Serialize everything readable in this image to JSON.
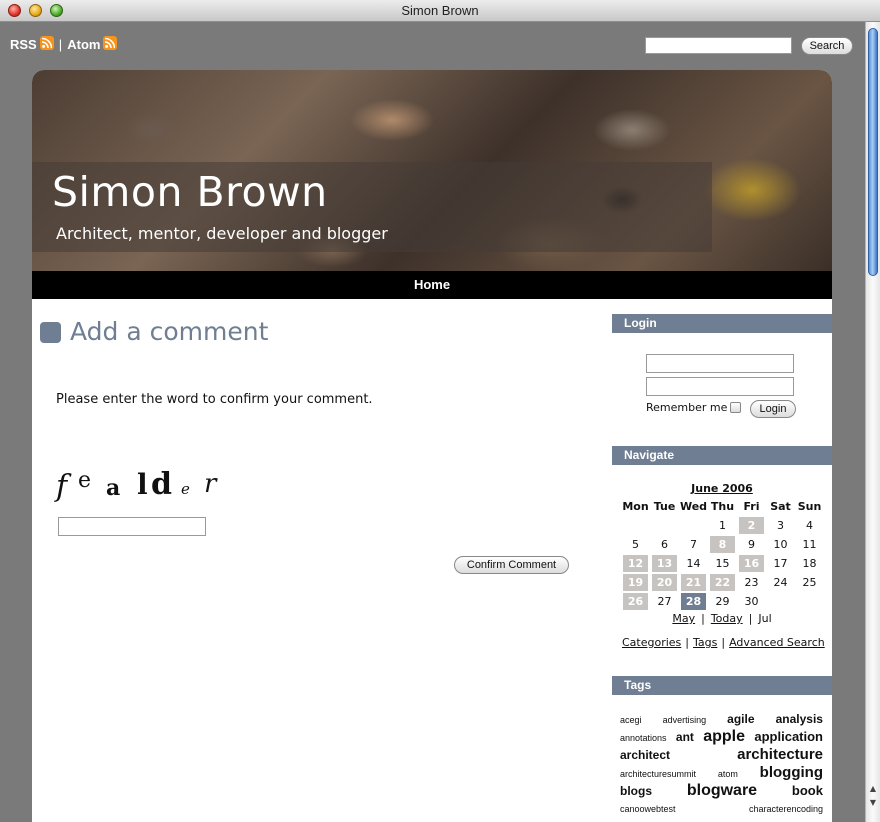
{
  "window": {
    "title": "Simon Brown"
  },
  "feeds": {
    "rss_label": "RSS",
    "separator": "|",
    "atom_label": "Atom"
  },
  "search": {
    "button_label": "Search",
    "value": ""
  },
  "site": {
    "title": "Simon Brown",
    "tagline": "Architect, mentor, developer and blogger"
  },
  "nav": {
    "home_label": "Home"
  },
  "main": {
    "heading": "Add a comment",
    "instructions": "Please enter the word to confirm your comment.",
    "captcha_word": "fealder",
    "confirm_label": "Confirm Comment"
  },
  "sidebar": {
    "login": {
      "header": "Login",
      "remember_label": "Remember me",
      "login_button": "Login"
    },
    "navigate": {
      "header": "Navigate",
      "month_label": "June 2006",
      "weekdays": [
        "Mon",
        "Tue",
        "Wed",
        "Thu",
        "Fri",
        "Sat",
        "Sun"
      ],
      "weeks": [
        [
          "",
          "",
          "",
          "1",
          "2",
          "3",
          "4"
        ],
        [
          "5",
          "6",
          "7",
          "8",
          "9",
          "10",
          "11"
        ],
        [
          "12",
          "13",
          "14",
          "15",
          "16",
          "17",
          "18"
        ],
        [
          "19",
          "20",
          "21",
          "22",
          "23",
          "24",
          "25"
        ],
        [
          "26",
          "27",
          "28",
          "29",
          "30",
          "",
          ""
        ]
      ],
      "days_with_posts": [
        "2",
        "8",
        "12",
        "13",
        "16",
        "19",
        "20",
        "21",
        "22",
        "26"
      ],
      "today": "28",
      "prev_label": "May",
      "today_label": "Today",
      "next_label": "Jul",
      "links": [
        "Categories",
        "Tags",
        "Advanced Search"
      ]
    },
    "tags": {
      "header": "Tags",
      "rows": [
        [
          {
            "label": "acegi",
            "size": 1
          },
          {
            "label": "advertising",
            "size": 1
          },
          {
            "label": "agile",
            "size": 3
          },
          {
            "label": "analysis",
            "size": 3
          }
        ],
        [
          {
            "label": "annotations",
            "size": 1
          },
          {
            "label": "ant",
            "size": 3
          },
          {
            "label": "apple",
            "size": 6
          },
          {
            "label": "application",
            "size": 4
          }
        ],
        [
          {
            "label": "architect",
            "size": 3
          },
          {
            "label": "architecture",
            "size": 5
          }
        ],
        [
          {
            "label": "architecturesummit",
            "size": 1
          },
          {
            "label": "atom",
            "size": 1
          },
          {
            "label": "blogging",
            "size": 5
          }
        ],
        [
          {
            "label": "blogs",
            "size": 3
          },
          {
            "label": "blogware",
            "size": 6
          },
          {
            "label": "book",
            "size": 4
          }
        ],
        [
          {
            "label": "canoowebtest",
            "size": 1
          },
          {
            "label": "characterencoding",
            "size": 1
          }
        ]
      ]
    }
  }
}
